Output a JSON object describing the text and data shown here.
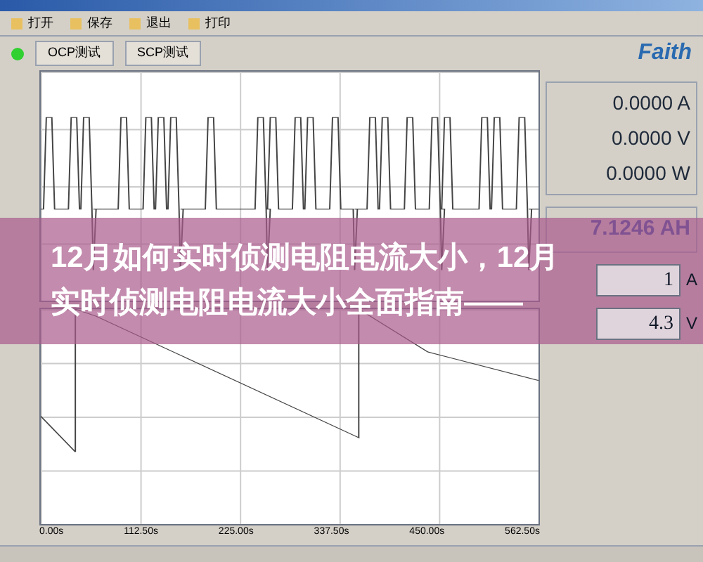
{
  "toolbar": {
    "items": [
      "打开",
      "保存",
      "退出",
      "打印"
    ]
  },
  "status": {
    "connected": true
  },
  "brand": "Faith",
  "bottom_chart": {
    "x_ticks": [
      "0.00s",
      "112.50s",
      "225.00s",
      "337.50s",
      "450.00s",
      "562.50s"
    ]
  },
  "readings": [
    {
      "value": "0.0000",
      "unit": "A"
    },
    {
      "value": "0.0000",
      "unit": "V"
    },
    {
      "value": "0.0000",
      "unit": "W"
    }
  ],
  "capacity": {
    "value": "7.1246",
    "unit": "AH"
  },
  "settings": [
    {
      "value": "1",
      "unit": "A"
    },
    {
      "value": "4.3",
      "unit": "V"
    }
  ],
  "tabs": [
    {
      "label": "OCP测试",
      "selected": false
    },
    {
      "label": "SCP测试",
      "selected": false
    }
  ],
  "overlay": {
    "title": "12月如何实时侦测电阻电流大小，12月实时侦测电阻电流大小全面指南——"
  }
}
